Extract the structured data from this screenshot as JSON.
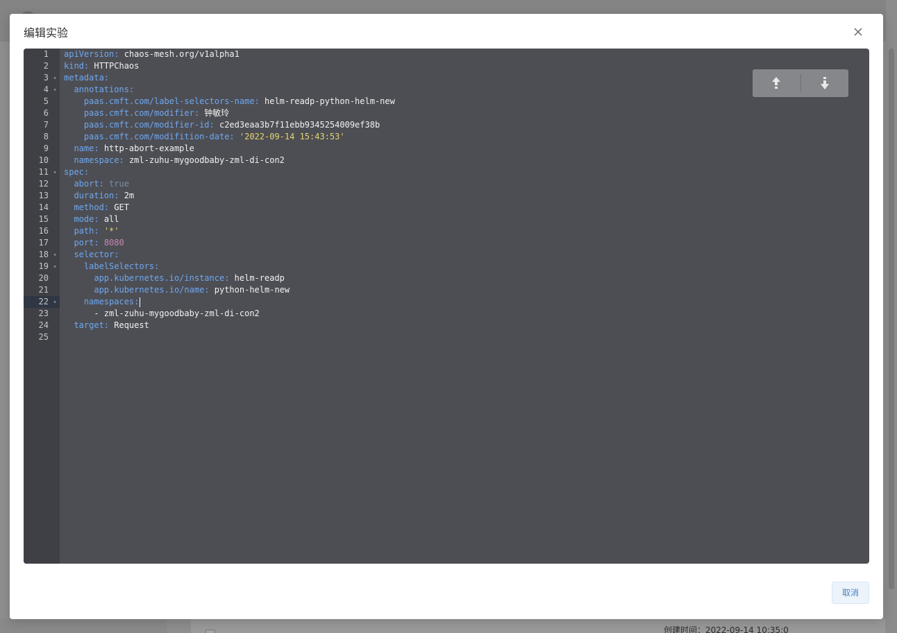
{
  "background": {
    "created_time_text": "创建时间：2022-09-14 10:35:0"
  },
  "modal": {
    "title": "编辑实验",
    "close_icon": "close-icon",
    "cancel_label": "取消"
  },
  "editor": {
    "active_line": 22,
    "nav": {
      "up_icon": "arrow-up-icon",
      "down_icon": "arrow-down-icon"
    },
    "lines": [
      {
        "num": "1",
        "fold": "",
        "indent": "",
        "key": "apiVersion",
        "sep": ": ",
        "val": "chaos-mesh.org/v1alpha1",
        "vtype": "v"
      },
      {
        "num": "2",
        "fold": "",
        "indent": "",
        "key": "kind",
        "sep": ": ",
        "val": "HTTPChaos",
        "vtype": "v"
      },
      {
        "num": "3",
        "fold": "▾",
        "indent": "",
        "key": "metadata",
        "sep": ":",
        "val": "",
        "vtype": "v"
      },
      {
        "num": "4",
        "fold": "▾",
        "indent": "  ",
        "key": "annotations",
        "sep": ":",
        "val": "",
        "vtype": "v"
      },
      {
        "num": "5",
        "fold": "",
        "indent": "    ",
        "key": "paas.cmft.com/label-selectors-name",
        "sep": ": ",
        "val": "helm-readp-python-helm-new",
        "vtype": "v"
      },
      {
        "num": "6",
        "fold": "",
        "indent": "    ",
        "key": "paas.cmft.com/modifier",
        "sep": ": ",
        "val": "钟敏玲",
        "vtype": "v"
      },
      {
        "num": "7",
        "fold": "",
        "indent": "    ",
        "key": "paas.cmft.com/modifier-id",
        "sep": ": ",
        "val": "c2ed3eaa3b7f11ebb9345254009ef38b",
        "vtype": "v"
      },
      {
        "num": "8",
        "fold": "",
        "indent": "    ",
        "key": "paas.cmft.com/modifition-date",
        "sep": ": ",
        "val": "'2022-09-14 15:43:53'",
        "vtype": "s"
      },
      {
        "num": "9",
        "fold": "",
        "indent": "  ",
        "key": "name",
        "sep": ": ",
        "val": "http-abort-example",
        "vtype": "v"
      },
      {
        "num": "10",
        "fold": "",
        "indent": "  ",
        "key": "namespace",
        "sep": ": ",
        "val": "zml-zuhu-mygoodbaby-zml-di-con2",
        "vtype": "v"
      },
      {
        "num": "11",
        "fold": "▾",
        "indent": "",
        "key": "spec",
        "sep": ":",
        "val": "",
        "vtype": "v"
      },
      {
        "num": "12",
        "fold": "",
        "indent": "  ",
        "key": "abort",
        "sep": ": ",
        "val": "true",
        "vtype": "b"
      },
      {
        "num": "13",
        "fold": "",
        "indent": "  ",
        "key": "duration",
        "sep": ": ",
        "val": "2m",
        "vtype": "v"
      },
      {
        "num": "14",
        "fold": "",
        "indent": "  ",
        "key": "method",
        "sep": ": ",
        "val": "GET",
        "vtype": "v"
      },
      {
        "num": "15",
        "fold": "",
        "indent": "  ",
        "key": "mode",
        "sep": ": ",
        "val": "all",
        "vtype": "v"
      },
      {
        "num": "16",
        "fold": "",
        "indent": "  ",
        "key": "path",
        "sep": ": ",
        "val": "'*'",
        "vtype": "s"
      },
      {
        "num": "17",
        "fold": "",
        "indent": "  ",
        "key": "port",
        "sep": ": ",
        "val": "8080",
        "vtype": "n"
      },
      {
        "num": "18",
        "fold": "▾",
        "indent": "  ",
        "key": "selector",
        "sep": ":",
        "val": "",
        "vtype": "v"
      },
      {
        "num": "19",
        "fold": "▾",
        "indent": "    ",
        "key": "labelSelectors",
        "sep": ":",
        "val": "",
        "vtype": "v"
      },
      {
        "num": "20",
        "fold": "",
        "indent": "      ",
        "key": "app.kubernetes.io/instance",
        "sep": ": ",
        "val": "helm-readp",
        "vtype": "v"
      },
      {
        "num": "21",
        "fold": "",
        "indent": "      ",
        "key": "app.kubernetes.io/name",
        "sep": ": ",
        "val": "python-helm-new",
        "vtype": "v"
      },
      {
        "num": "22",
        "fold": "▾",
        "indent": "    ",
        "key": "namespaces",
        "sep": ":",
        "val": "",
        "vtype": "v"
      },
      {
        "num": "23",
        "fold": "",
        "indent": "      ",
        "key": "",
        "sep": "",
        "val": "- zml-zuhu-mygoodbaby-zml-di-con2",
        "vtype": "v"
      },
      {
        "num": "24",
        "fold": "",
        "indent": "  ",
        "key": "target",
        "sep": ": ",
        "val": "Request",
        "vtype": "v"
      },
      {
        "num": "25",
        "fold": "",
        "indent": "",
        "key": "",
        "sep": "",
        "val": "",
        "vtype": "v"
      }
    ]
  }
}
